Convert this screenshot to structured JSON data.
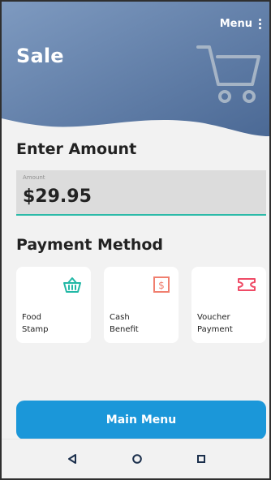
{
  "header": {
    "title": "Sale",
    "menu_label": "Menu",
    "menu_icon": "kebab-icon",
    "decorative_icon": "shopping-cart-icon"
  },
  "amount_section": {
    "title": "Enter Amount",
    "field_label": "Amount",
    "value": "$29.95"
  },
  "payment_section": {
    "title": "Payment Method",
    "methods": [
      {
        "label": "Food\nStamp",
        "icon": "basket-icon",
        "icon_color": "#22b8a6"
      },
      {
        "label": "Cash\nBenefit",
        "icon": "dollar-icon",
        "icon_color": "#f07f6f"
      },
      {
        "label": "Voucher\nPayment",
        "icon": "ticket-icon",
        "icon_color": "#ef4b66"
      }
    ]
  },
  "primary_action": {
    "label": "Main Menu"
  },
  "system_nav": {
    "back_icon": "back-icon",
    "home_icon": "home-icon",
    "recent_icon": "recent-apps-icon"
  },
  "colors": {
    "header_blue": "#5f7ea7",
    "accent_teal": "#2bbaa8",
    "button_blue": "#1b97d9",
    "background": "#f2f2f2"
  }
}
